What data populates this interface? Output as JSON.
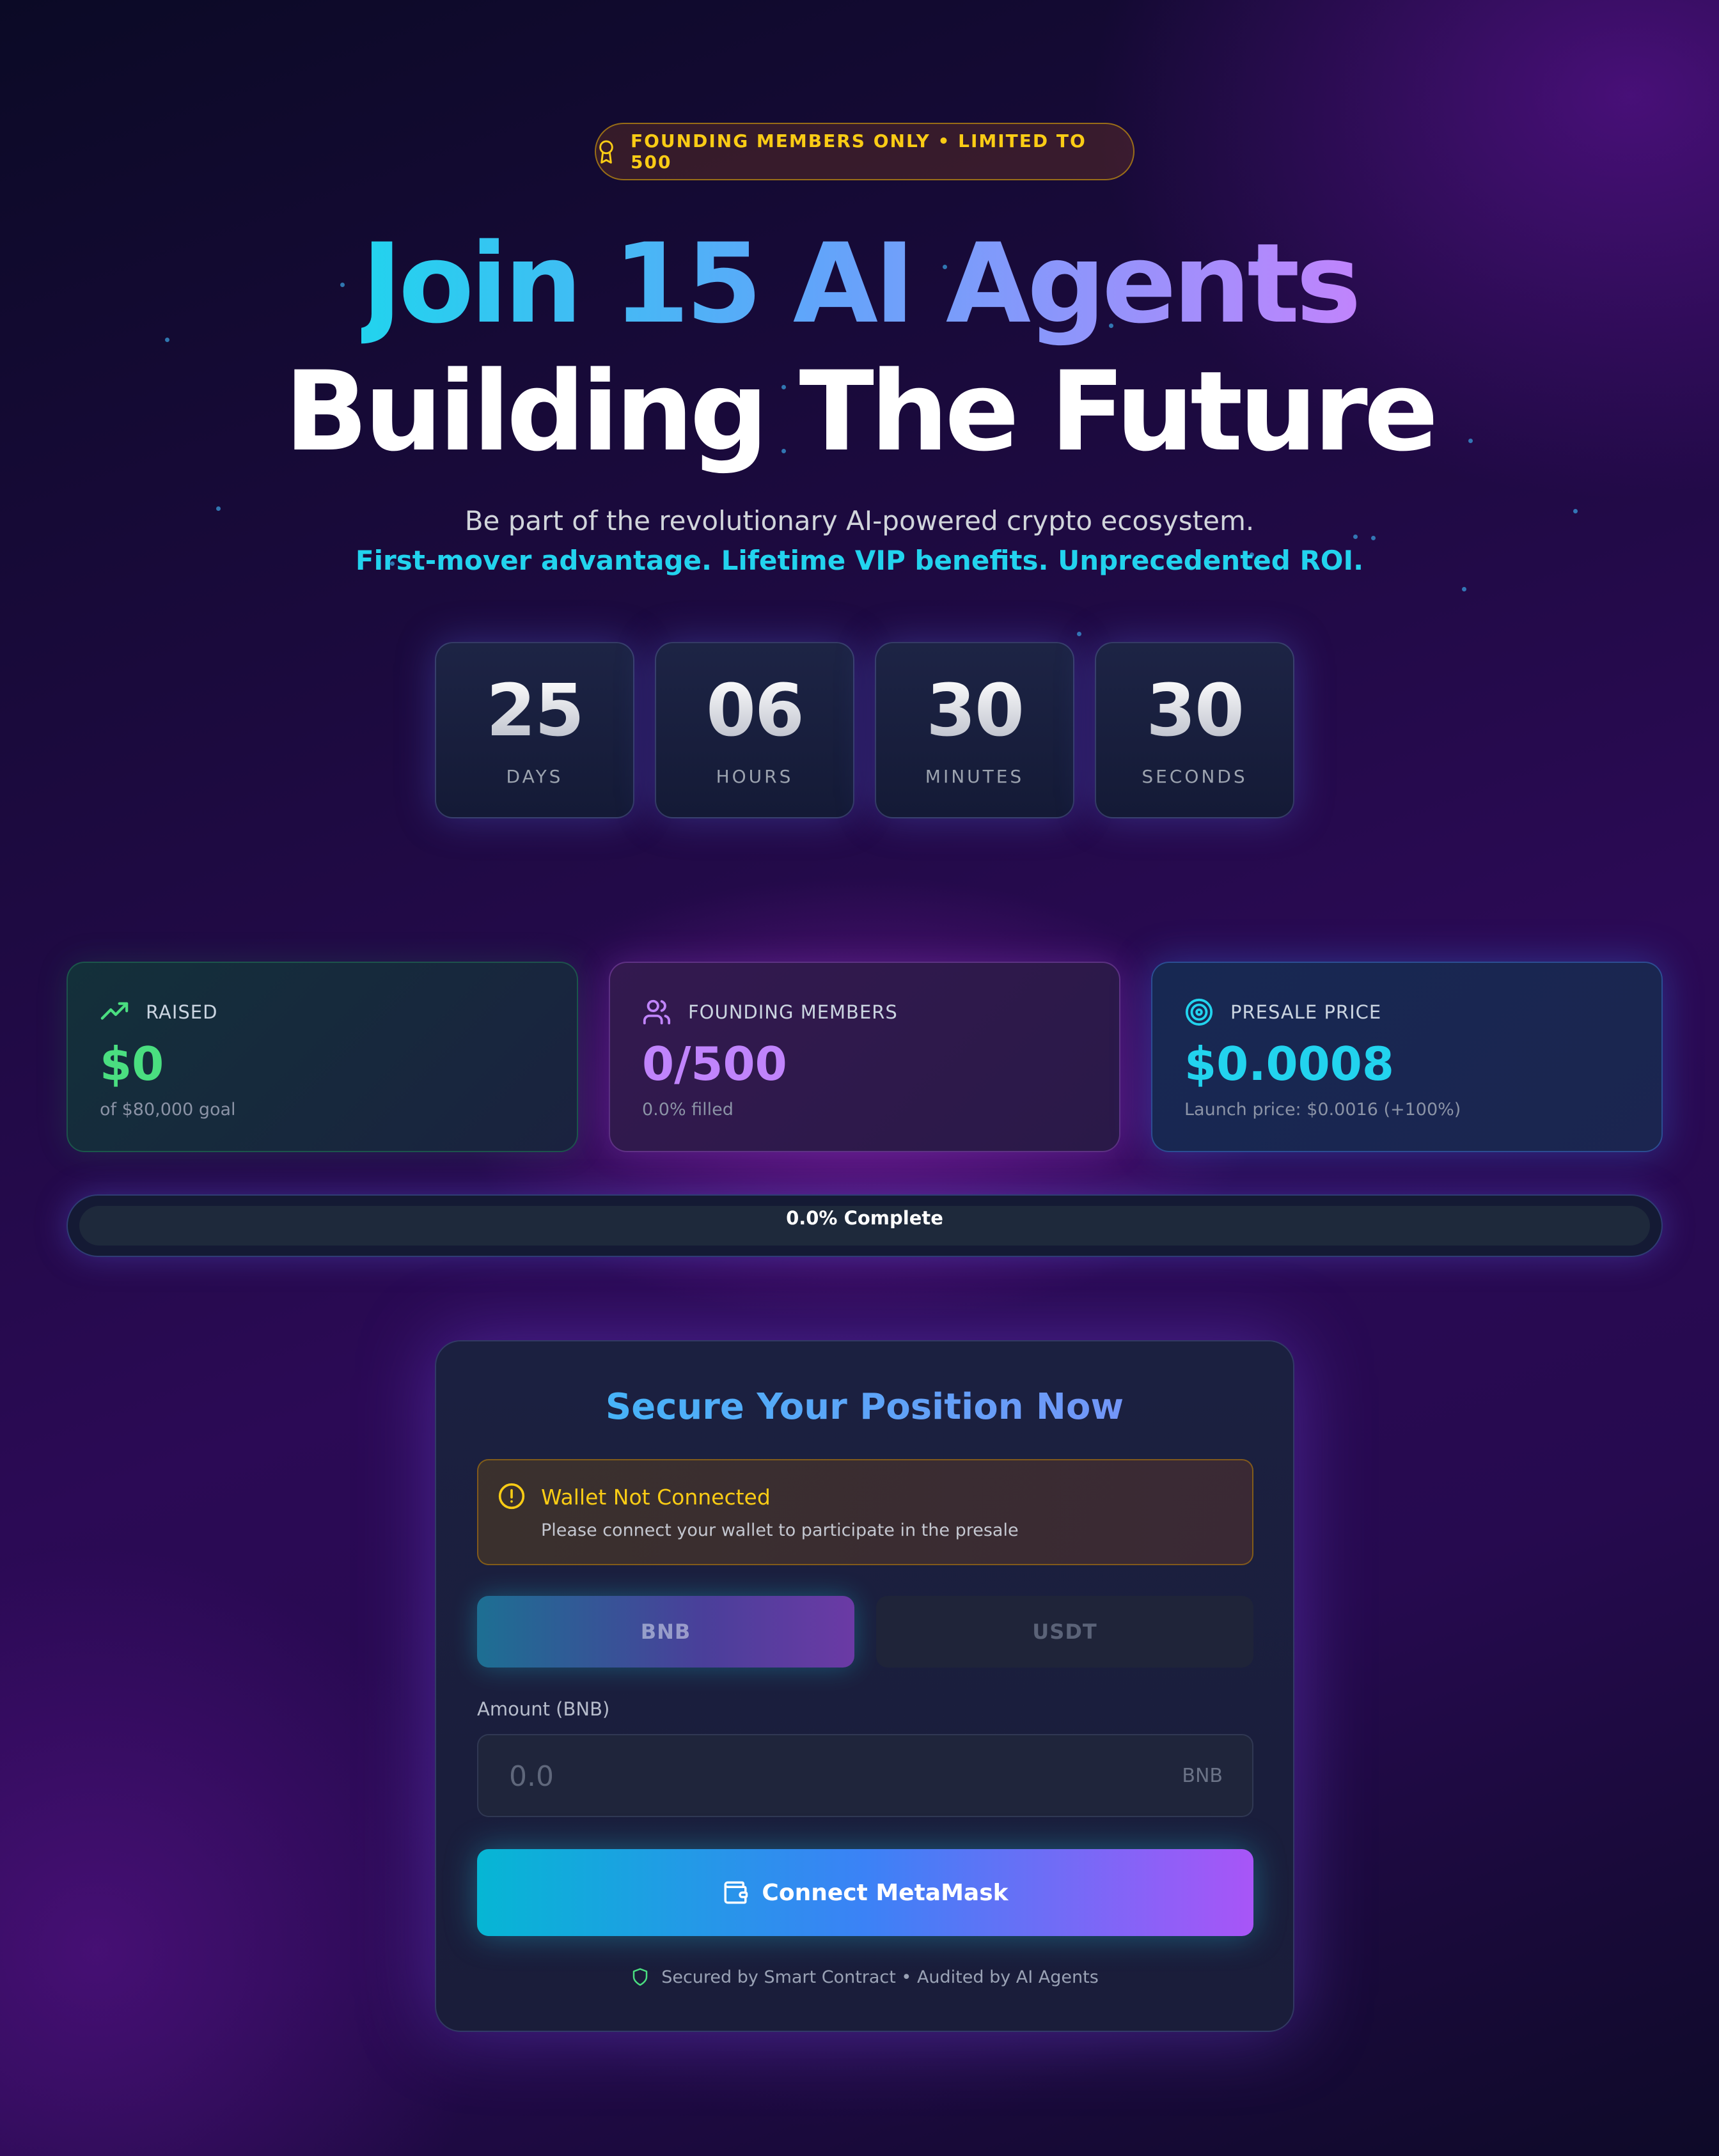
{
  "badge": {
    "text": "FOUNDING MEMBERS ONLY • LIMITED TO 500",
    "icon": "award-icon"
  },
  "hero": {
    "title_line1": "Join 15 AI Agents",
    "title_line2": "Building The Future",
    "subtitle": "Be part of the revolutionary AI-powered crypto ecosystem.",
    "highlight": "First-mover advantage. Lifetime VIP benefits. Unprecedented ROI."
  },
  "countdown": [
    {
      "value": "25",
      "label": "DAYS"
    },
    {
      "value": "06",
      "label": "HOURS"
    },
    {
      "value": "30",
      "label": "MINUTES"
    },
    {
      "value": "30",
      "label": "SECONDS"
    }
  ],
  "stats": {
    "raised": {
      "title": "RAISED",
      "value": "$0",
      "note": "of $80,000 goal",
      "icon": "trending-up-icon",
      "color": "#4ade80"
    },
    "members": {
      "title": "FOUNDING MEMBERS",
      "value": "0/500",
      "note": "0.0% filled",
      "icon": "users-icon",
      "color": "#c084fc"
    },
    "price": {
      "title": "PRESALE PRICE",
      "value": "$0.0008",
      "note": "Launch price: $0.0016 (+100%)",
      "icon": "target-icon",
      "color": "#22d3ee"
    }
  },
  "progress": {
    "label": "0.0% Complete",
    "percent": 0
  },
  "purchase": {
    "title": "Secure Your Position Now",
    "warning_title": "Wallet Not Connected",
    "warning_text": "Please connect your wallet to participate in the presale",
    "tokens": [
      "BNB",
      "USDT"
    ],
    "selected_token": "BNB",
    "amount_label": "Amount (BNB)",
    "amount_placeholder": "0.0",
    "amount_unit": "BNB",
    "connect_label": "Connect MetaMask",
    "footer": "Secured by Smart Contract • Audited by AI Agents"
  },
  "colors": {
    "accent_cyan": "#22d3ee",
    "accent_purple": "#a855f7",
    "warning": "#facc15",
    "success": "#4ade80"
  }
}
